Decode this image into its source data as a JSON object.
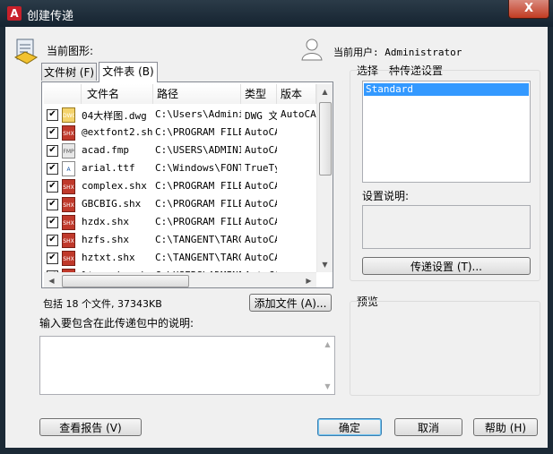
{
  "window": {
    "title": "创建传递",
    "app_icon": "A",
    "close_glyph": "X"
  },
  "current_drawing_label": "当前图形:",
  "current_user": "当前用户: Administrator",
  "tabs": [
    {
      "label": "文件树 (F)"
    },
    {
      "label": "文件表 (B)"
    }
  ],
  "file_table": {
    "columns": [
      "文件名",
      "路径",
      "类型",
      "版本"
    ],
    "rows": [
      {
        "checked": true,
        "icon": "dwg-file-icon",
        "name": "04大样图.dwg",
        "path": "C:\\Users\\Adminis",
        "type": "DWG 文",
        "version": "AutoCAD"
      },
      {
        "checked": true,
        "icon": "shx-file-icon",
        "name": "@extfont2.shx",
        "path": "C:\\PROGRAM FILES",
        "type": "AutoCA",
        "version": ""
      },
      {
        "checked": true,
        "icon": "fmp-file-icon",
        "name": "acad.fmp",
        "path": "C:\\USERS\\ADMINIS",
        "type": "AutoCA",
        "version": ""
      },
      {
        "checked": true,
        "icon": "ttf-file-icon",
        "name": "arial.ttf",
        "path": "C:\\Windows\\FONTS",
        "type": "TrueTy",
        "version": ""
      },
      {
        "checked": true,
        "icon": "shx-file-icon",
        "name": "complex.shx",
        "path": "C:\\PROGRAM FILES",
        "type": "AutoCA",
        "version": ""
      },
      {
        "checked": true,
        "icon": "shx-file-icon",
        "name": "GBCBIG.shx",
        "path": "C:\\PROGRAM FILES",
        "type": "AutoCA",
        "version": ""
      },
      {
        "checked": true,
        "icon": "shx-file-icon",
        "name": "hzdx.shx",
        "path": "C:\\PROGRAM FILES",
        "type": "AutoCA",
        "version": ""
      },
      {
        "checked": true,
        "icon": "shx-file-icon",
        "name": "hzfs.shx",
        "path": "C:\\TANGENT\\TARCH",
        "type": "AutoCA",
        "version": ""
      },
      {
        "checked": true,
        "icon": "shx-file-icon",
        "name": "hztxt.shx",
        "path": "C:\\TANGENT\\TARCH",
        "type": "AutoCA",
        "version": ""
      },
      {
        "checked": true,
        "icon": "shx-file-icon",
        "name": "ltypeshp.shx",
        "path": "C:\\USERS\\ADMINIS",
        "type": "AutoCA",
        "version": ""
      }
    ]
  },
  "summary": "包括 18 个文件, 37343KB",
  "add_file_button": "添加文件 (A)...",
  "notes_label": "输入要包含在此传递包中的说明:",
  "notes_value": "",
  "transmittal_setup": {
    "label": "选择一种传递设置",
    "items": [
      "Standard"
    ],
    "selected": "Standard",
    "description_label": "设置说明:",
    "description_value": "",
    "setup_button": "传递设置 (T)..."
  },
  "preview_label": "预览",
  "buttons": {
    "view_report": "查看报告 (V)",
    "ok": "确定",
    "cancel": "取消",
    "help": "帮助 (H)"
  },
  "colors": {
    "selection": "#3399ff",
    "shx_icon": "#c0392b",
    "title_bar": "#1c2a36"
  }
}
